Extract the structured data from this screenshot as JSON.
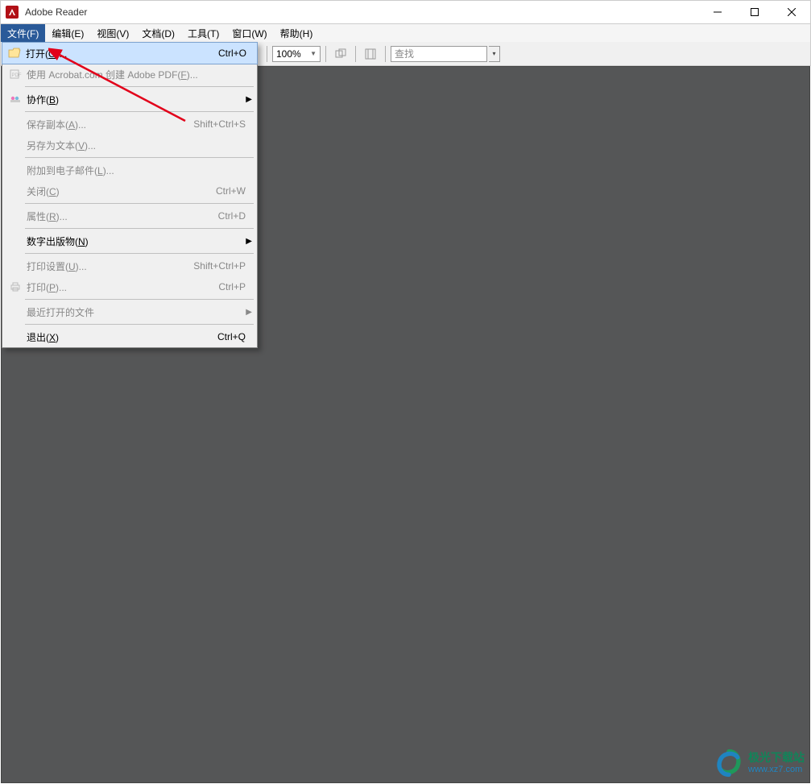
{
  "window": {
    "title": "Adobe Reader"
  },
  "menubar": {
    "items": [
      {
        "label": "文件(F)",
        "active": true
      },
      {
        "label": "编辑(E)"
      },
      {
        "label": "视图(V)"
      },
      {
        "label": "文档(D)"
      },
      {
        "label": "工具(T)"
      },
      {
        "label": "窗口(W)"
      },
      {
        "label": "帮助(H)"
      }
    ]
  },
  "toolbar": {
    "zoom_value": "100%",
    "find_placeholder": "查找"
  },
  "file_menu": {
    "open": {
      "label": "打开(",
      "accel": "O",
      "suffix": ")...",
      "shortcut": "Ctrl+O"
    },
    "create_pdf": {
      "label": "使用 Acrobat.com 创建 Adobe PDF(",
      "accel": "F",
      "suffix": ")..."
    },
    "collaborate": {
      "label": "协作(",
      "accel": "B",
      "suffix": ")"
    },
    "save_copy": {
      "label": "保存副本(",
      "accel": "A",
      "suffix": ")...",
      "shortcut": "Shift+Ctrl+S"
    },
    "save_as_text": {
      "label": "另存为文本(",
      "accel": "V",
      "suffix": ")..."
    },
    "attach_email": {
      "label": "附加到电子邮件(",
      "accel": "L",
      "suffix": ")..."
    },
    "close": {
      "label": "关闭(",
      "accel": "C",
      "suffix": ")",
      "shortcut": "Ctrl+W"
    },
    "properties": {
      "label": "属性(",
      "accel": "R",
      "suffix": ")...",
      "shortcut": "Ctrl+D"
    },
    "digital_pub": {
      "label": "数字出版物(",
      "accel": "N",
      "suffix": ")"
    },
    "print_setup": {
      "label": "打印设置(",
      "accel": "U",
      "suffix": ")...",
      "shortcut": "Shift+Ctrl+P"
    },
    "print": {
      "label": "打印(",
      "accel": "P",
      "suffix": ")...",
      "shortcut": "Ctrl+P"
    },
    "recent": {
      "label": "最近打开的文件"
    },
    "exit": {
      "label": "退出(",
      "accel": "X",
      "suffix": ")",
      "shortcut": "Ctrl+Q"
    }
  },
  "watermark": {
    "line1": "极光下载站",
    "line2": "www.xz7.com"
  }
}
